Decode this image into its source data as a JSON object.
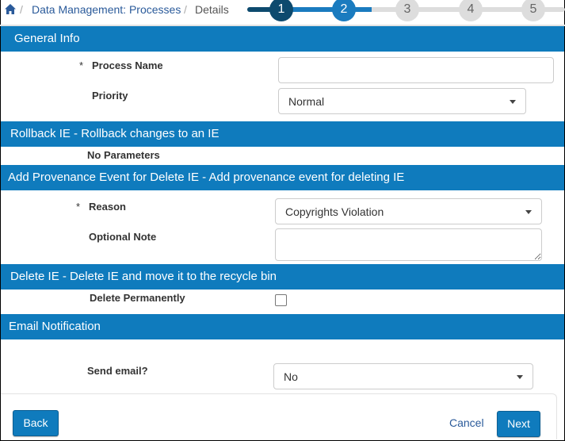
{
  "breadcrumb": {
    "home_icon": "home-icon",
    "items": [
      "Data Management: Processes",
      "Details"
    ]
  },
  "stepper": {
    "steps": [
      "1",
      "2",
      "3",
      "4",
      "5"
    ],
    "current": 2,
    "colors": {
      "done": "#0d4a6e",
      "active": "#1a7bbf",
      "pending": "#dddddd"
    }
  },
  "sections": {
    "general": {
      "title": "General Info",
      "process_name_label": "Process Name",
      "process_name_value": "",
      "priority_label": "Priority",
      "priority_value": "Normal"
    },
    "rollback": {
      "title": "Rollback IE - Rollback changes to an IE",
      "no_params": "No Parameters"
    },
    "provenance": {
      "title": "Add Provenance Event for Delete IE - Add provenance event for deleting IE",
      "reason_label": "Reason",
      "reason_value": "Copyrights Violation",
      "note_label": "Optional Note",
      "note_value": ""
    },
    "delete": {
      "title": "Delete IE - Delete IE and move it to the recycle bin",
      "permanent_label": "Delete Permanently",
      "permanent_checked": false
    },
    "email": {
      "title": "Email Notification",
      "send_label": "Send email?",
      "send_value": "No"
    }
  },
  "required_mark": "*",
  "footer": {
    "back": "Back",
    "cancel": "Cancel",
    "next": "Next"
  },
  "accent": "#0f7bbd"
}
